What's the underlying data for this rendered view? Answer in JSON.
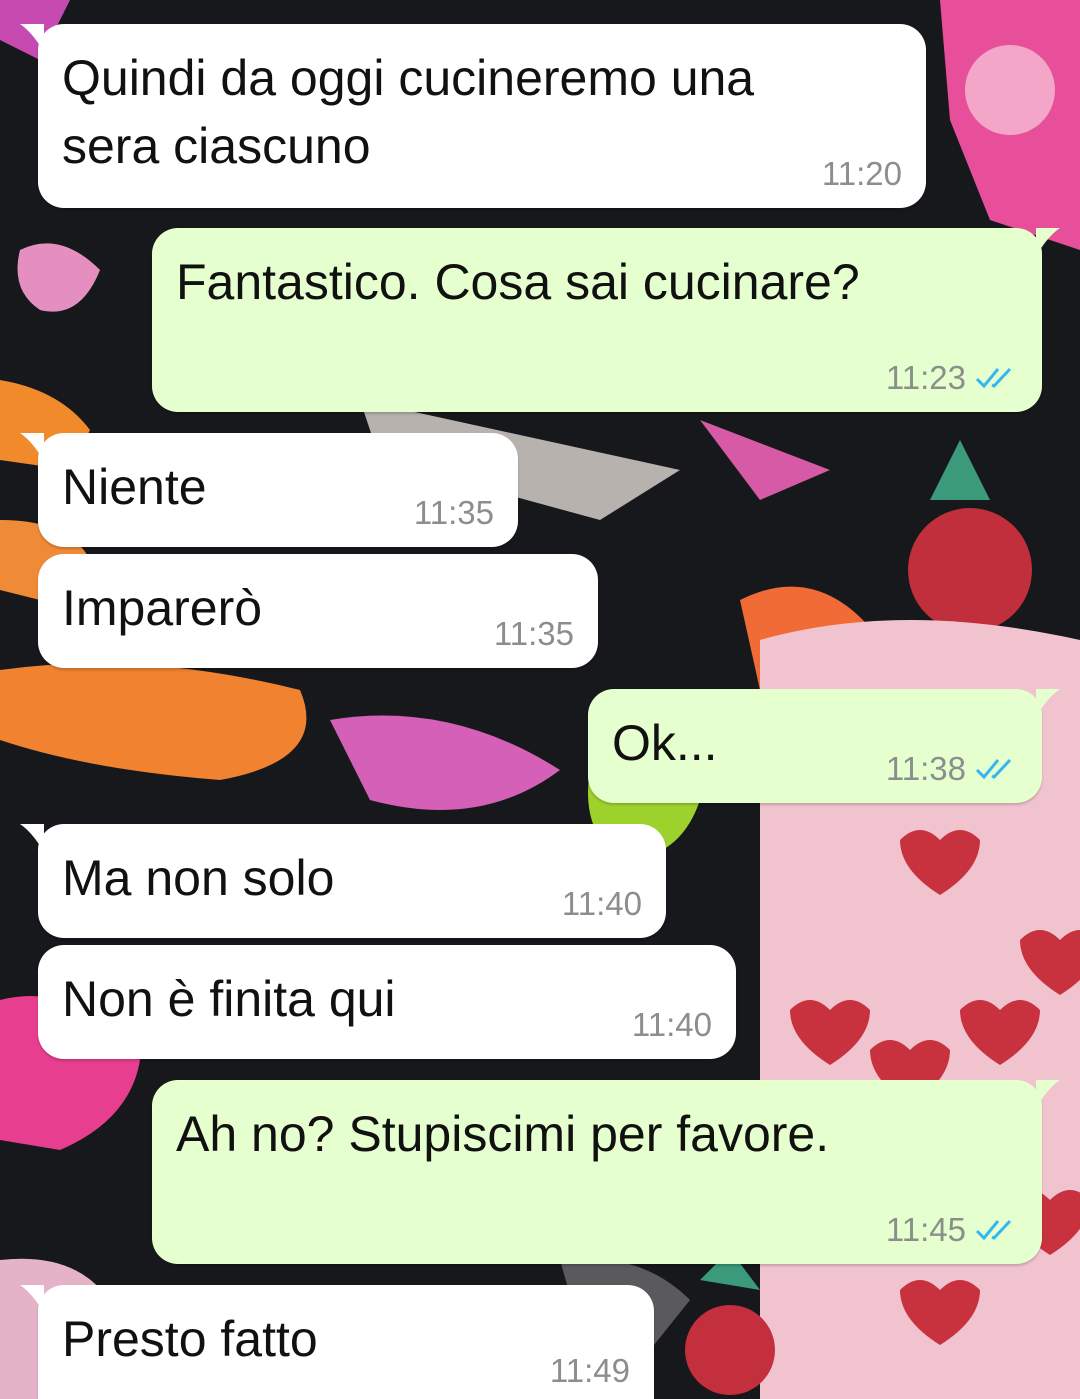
{
  "chat": {
    "messages": [
      {
        "direction": "in",
        "text_lines": [
          "Quindi da oggi cucineremo una",
          "sera ciascuno"
        ],
        "time": "11:20"
      },
      {
        "direction": "out",
        "text_lines": [
          "Fantastico. Cosa sai cucinare?"
        ],
        "time": "11:23",
        "status_icon": "double-check-read-icon"
      },
      {
        "direction": "in",
        "text_lines": [
          "Niente"
        ],
        "time": "11:35"
      },
      {
        "direction": "in",
        "text_lines": [
          "Imparerò"
        ],
        "time": "11:35"
      },
      {
        "direction": "out",
        "text_lines": [
          "Ok..."
        ],
        "time": "11:38",
        "status_icon": "double-check-read-icon"
      },
      {
        "direction": "in",
        "text_lines": [
          "Ma non solo"
        ],
        "time": "11:40"
      },
      {
        "direction": "in",
        "text_lines": [
          "Non è finita qui"
        ],
        "time": "11:40"
      },
      {
        "direction": "out",
        "text_lines": [
          "Ah no? Stupiscimi per favore."
        ],
        "time": "11:45",
        "status_icon": "double-check-read-icon"
      },
      {
        "direction": "in",
        "text_lines": [
          "Presto fatto"
        ],
        "time": "11:49"
      }
    ]
  },
  "colors": {
    "incoming_bubble": "#ffffff",
    "outgoing_bubble": "#e6ffcf",
    "read_ticks": "#34b7f1",
    "timestamp": "#8b8f8c",
    "wallpaper_base": "#16181c"
  }
}
